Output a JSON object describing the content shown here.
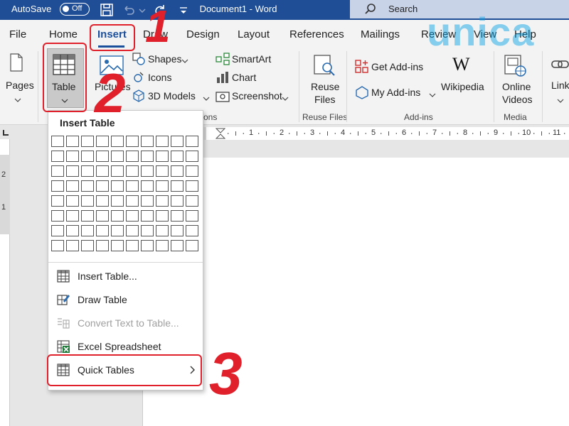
{
  "titlebar": {
    "autosave_label": "AutoSave",
    "autosave_state": "Off",
    "document_title": "Document1  -  Word",
    "search_placeholder": "Search",
    "bar_color": "#1f4e96"
  },
  "tabs": [
    "File",
    "Home",
    "Insert",
    "Draw",
    "Design",
    "Layout",
    "References",
    "Mailings",
    "Review",
    "View",
    "Help"
  ],
  "active_tab": "Insert",
  "ribbon": {
    "pages_label": "Pages",
    "table_label": "Table",
    "pictures_label": "Pictures",
    "shapes_label": "Shapes",
    "icons_label": "Icons",
    "models_label": "3D Models",
    "smartart_label": "SmartArt",
    "chart_label": "Chart",
    "screenshot_label": "Screenshot",
    "reuse_files_line1": "Reuse",
    "reuse_files_line2": "Files",
    "get_addins_label": "Get Add-ins",
    "my_addins_label": "My Add-ins",
    "wikipedia_label": "Wikipedia",
    "online_videos_line1": "Online",
    "online_videos_line2": "Videos",
    "links_label": "Links",
    "group_illustrations_tail": "ons",
    "group_reuse_files": "Reuse Files",
    "group_addins": "Add-ins",
    "group_media": "Media"
  },
  "ruler_numbers": [
    "1",
    "2",
    "3",
    "4",
    "5",
    "6",
    "7",
    "8",
    "9",
    "10",
    "11"
  ],
  "vruler_numbers": [
    "2",
    "1"
  ],
  "insert_table_menu": {
    "header": "Insert Table",
    "grid_cols": 10,
    "grid_rows": 8,
    "items": [
      {
        "label": "Insert Table...",
        "icon": "table-grid-icon",
        "enabled": true
      },
      {
        "label": "Draw Table",
        "icon": "pencil-table-icon",
        "enabled": true
      },
      {
        "label": "Convert Text to Table...",
        "icon": "convert-text-icon",
        "enabled": false
      },
      {
        "label": "Excel Spreadsheet",
        "icon": "excel-icon",
        "enabled": true
      },
      {
        "label": "Quick Tables",
        "icon": "quick-table-icon",
        "enabled": true,
        "has_submenu": true
      }
    ]
  },
  "annotations": {
    "step1": "1",
    "step2": "2",
    "step3": "3",
    "highlight_color": "#e0202a"
  },
  "watermark": "unica"
}
